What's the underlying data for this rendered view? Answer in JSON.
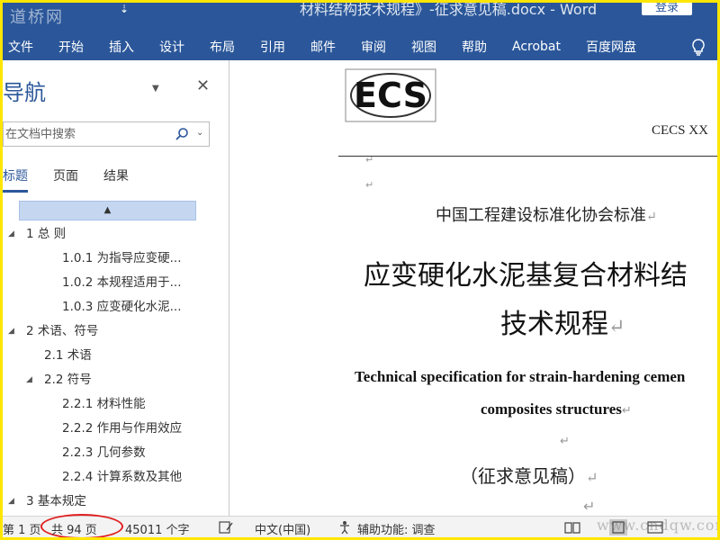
{
  "watermark_top": "道桥网",
  "window": {
    "title": "材料结构技术规程》-征求意见稿.docx  -  Word",
    "login": "登录"
  },
  "ribbon": {
    "tabs": [
      "文件",
      "开始",
      "插入",
      "设计",
      "布局",
      "引用",
      "邮件",
      "审阅",
      "视图",
      "帮助",
      "Acrobat",
      "百度网盘"
    ]
  },
  "nav": {
    "title": "导航",
    "search_placeholder": "在文档中搜索",
    "tabs": [
      "标题",
      "页面",
      "结果"
    ],
    "active_tab": 0,
    "collapse_glyph": "▲",
    "outline": [
      {
        "text": "1 总 则",
        "level": 1,
        "expanded": true
      },
      {
        "text": "1.0.1 为指导应变硬...",
        "level": 3
      },
      {
        "text": "1.0.2 本规程适用于...",
        "level": 3
      },
      {
        "text": "1.0.3 应变硬化水泥...",
        "level": 3
      },
      {
        "text": "2 术语、符号",
        "level": 1,
        "expanded": true
      },
      {
        "text": "2.1 术语",
        "level": 2
      },
      {
        "text": "2.2 符号",
        "level": 2,
        "expanded": true
      },
      {
        "text": "2.2.1 材料性能",
        "level": 3
      },
      {
        "text": "2.2.2 作用与作用效应",
        "level": 3
      },
      {
        "text": "2.2.3 几何参数",
        "level": 3
      },
      {
        "text": "2.2.4 计算系数及其他",
        "level": 3
      },
      {
        "text": "3 基本规定",
        "level": 1,
        "expanded": true
      }
    ]
  },
  "document": {
    "logo_text": "ECS",
    "cecs": "CECS   XX",
    "association": "中国工程建设标准化协会标准",
    "title_line1": "应变硬化水泥基复合材料结",
    "title_line2": "技术规程",
    "en_line1": "Technical specification for strain-hardening cemen",
    "en_line2": "composites structures",
    "draft": "（征求意见稿）",
    "para_mark": "↵"
  },
  "status": {
    "page": "第 1 页",
    "total": "共 94 页",
    "words": "45011 个字",
    "language": "中文(中国)",
    "accessibility": "辅助功能: 调查"
  },
  "watermark_bottom": "www.cndqw.com",
  "colors": {
    "accent": "#2b579a",
    "highlight": "#e02020",
    "border": "#ffe600"
  }
}
